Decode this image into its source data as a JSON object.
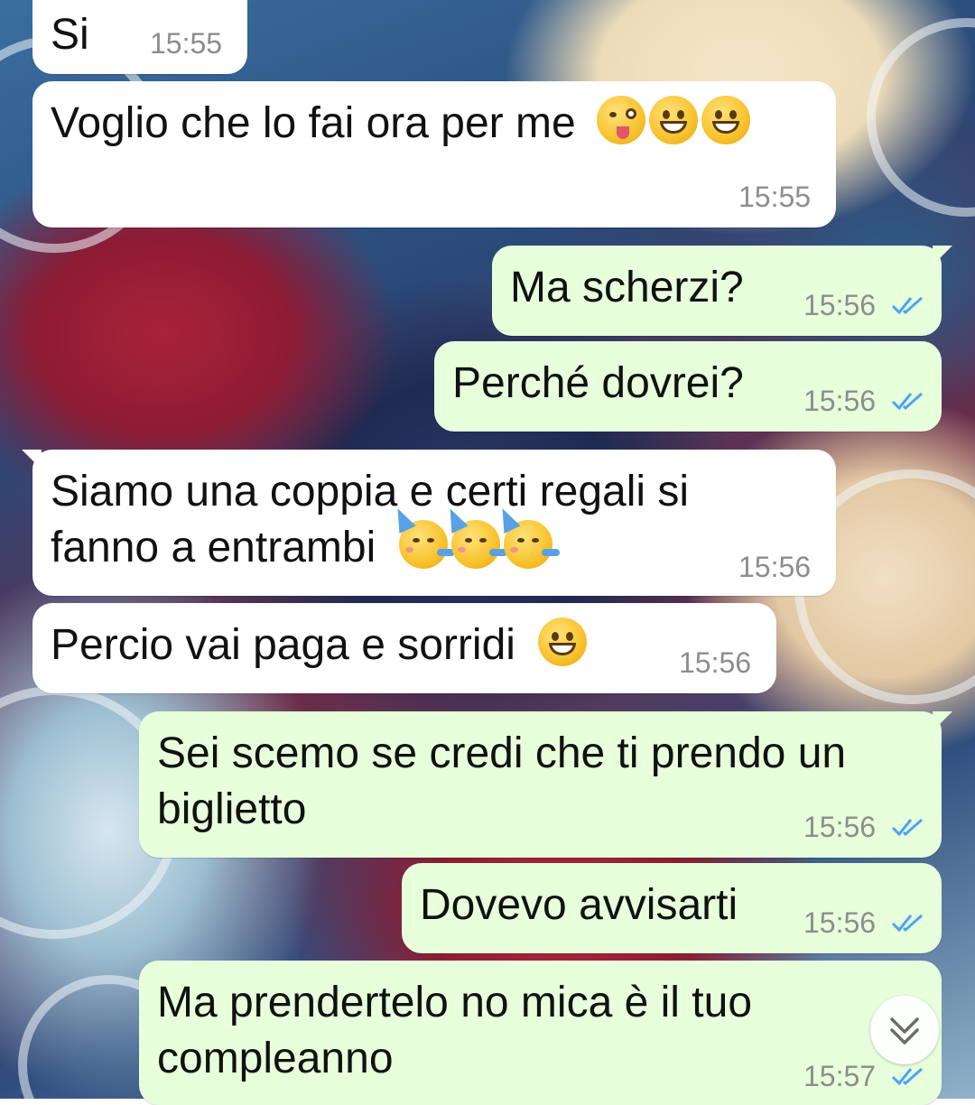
{
  "messages": [
    {
      "direction": "in",
      "text": "Si",
      "time": "15:55"
    },
    {
      "direction": "in",
      "text": "Voglio che lo fai ora per me",
      "emojis": [
        "winking-face-with-tongue-emoji",
        "grinning-face-emoji",
        "grinning-face-emoji"
      ],
      "time": "15:55"
    },
    {
      "direction": "out",
      "text": "Ma scherzi?",
      "time": "15:56",
      "status": "read"
    },
    {
      "direction": "out",
      "text": "Perché dovrei?",
      "time": "15:56",
      "status": "read"
    },
    {
      "direction": "in",
      "line1": "Siamo una coppia e certi regali si",
      "line2": "fanno a entrambi",
      "emojis": [
        "partying-face-emoji",
        "partying-face-emoji",
        "partying-face-emoji"
      ],
      "time": "15:56"
    },
    {
      "direction": "in",
      "text": "Percio vai paga e sorridi",
      "emojis": [
        "grinning-face-emoji"
      ],
      "time": "15:56"
    },
    {
      "direction": "out",
      "line1": "Sei scemo se credi che ti prendo un",
      "line2": "biglietto",
      "time": "15:56",
      "status": "read"
    },
    {
      "direction": "out",
      "text": "Dovevo avvisarti",
      "time": "15:56",
      "status": "read"
    },
    {
      "direction": "out",
      "line1": "Ma prendertelo no mica è il tuo",
      "line2": "compleanno",
      "time": "15:57",
      "status": "read"
    }
  ],
  "colors": {
    "incoming_bubble": "#ffffff",
    "outgoing_bubble": "#e7ffdb",
    "read_ticks": "#4fa3f0",
    "timestamp": "#8d8d8d"
  },
  "icons": {
    "scroll_down": "double-chevron-down-icon",
    "read_status": "double-check-icon"
  }
}
